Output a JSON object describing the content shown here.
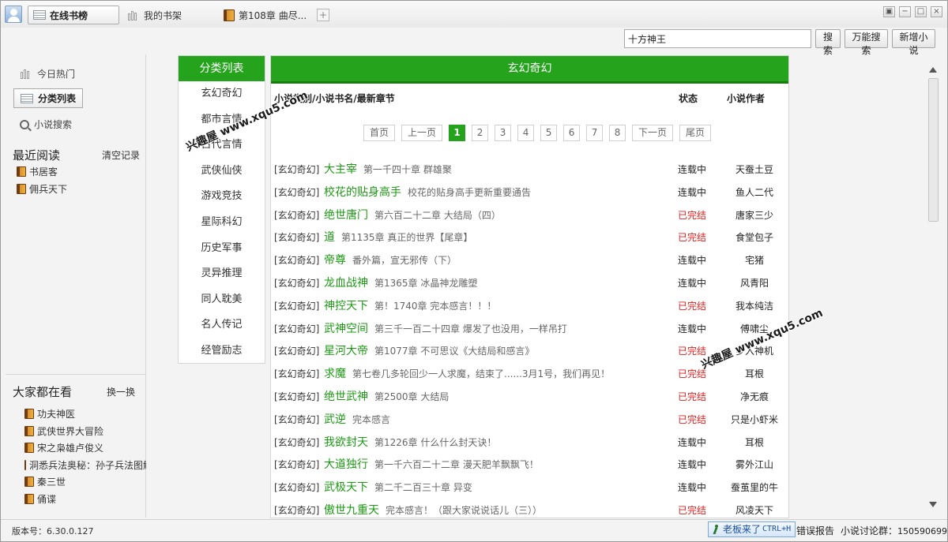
{
  "titlebar": {
    "tabs": [
      {
        "label": "在线书榜",
        "icon": "list-icon",
        "active": true
      },
      {
        "label": "我的书架",
        "icon": "bookshelf-icon",
        "active": false
      },
      {
        "label": "第108章  曲尽...",
        "icon": "book-icon",
        "active": false
      }
    ],
    "add_tab": "+",
    "window_buttons": {
      "restore": "▣",
      "minimize": "−",
      "maximize": "□",
      "close": "×"
    }
  },
  "search": {
    "value": "十方神王",
    "buttons": [
      "搜索",
      "万能搜索",
      "新增小说"
    ]
  },
  "left": {
    "nav": [
      {
        "label": "今日热门",
        "icon": "bookshelf-icon"
      },
      {
        "label": "分类列表",
        "icon": "list-icon"
      },
      {
        "label": "小说搜索",
        "icon": "search-icon"
      }
    ],
    "recent": {
      "title": "最近阅读",
      "clear": "清空记录",
      "items": [
        "书居客",
        "佣兵天下"
      ]
    },
    "popular": {
      "title": "大家都在看",
      "refresh": "换一换",
      "items": [
        "功夫神医",
        "武侠世界大冒险",
        "宋之枭雄卢俊义",
        "洞悉兵法奥秘：孙子兵法图解",
        "秦三世",
        "俑谍"
      ]
    }
  },
  "categories": {
    "title": "分类列表",
    "items": [
      "玄幻奇幻",
      "都市言情",
      "古代言情",
      "武侠仙侠",
      "游戏竞技",
      "星际科幻",
      "历史军事",
      "灵异推理",
      "同人耽美",
      "名人传记",
      "经管励志"
    ]
  },
  "main": {
    "title": "玄幻奇幻",
    "columns": {
      "book": "小说类别/小说书名/最新章节",
      "status": "状态",
      "author": "小说作者"
    },
    "pagination": {
      "first": "首页",
      "prev": "上一页",
      "pages": [
        "1",
        "2",
        "3",
        "4",
        "5",
        "6",
        "7",
        "8"
      ],
      "current": "1",
      "next": "下一页",
      "last": "尾页"
    },
    "rows": [
      {
        "category": "[玄幻奇幻]",
        "title": "大主宰",
        "chapter": "第一千四十章 群雄聚",
        "status": "连载中",
        "author": "天蚕土豆"
      },
      {
        "category": "[玄幻奇幻]",
        "title": "校花的贴身高手",
        "chapter": "校花的贴身高手更新重要通告",
        "status": "连载中",
        "author": "鱼人二代"
      },
      {
        "category": "[玄幻奇幻]",
        "title": "绝世唐门",
        "chapter": "第六百二十二章 大结局（四）",
        "status": "已完结",
        "author": "唐家三少"
      },
      {
        "category": "[玄幻奇幻]",
        "title": "道",
        "chapter": "第1135章 真正的世界【尾章】",
        "status": "已完结",
        "author": "食堂包子"
      },
      {
        "category": "[玄幻奇幻]",
        "title": "帝尊",
        "chapter": "番外篇，宣无邪传（下）",
        "status": "连载中",
        "author": "宅猪"
      },
      {
        "category": "[玄幻奇幻]",
        "title": "龙血战神",
        "chapter": "第1365章 冰晶神龙雕塑",
        "status": "连载中",
        "author": "风青阳"
      },
      {
        "category": "[玄幻奇幻]",
        "title": "神控天下",
        "chapter": "第！1740章 完本感言！！！",
        "status": "已完结",
        "author": "我本纯洁"
      },
      {
        "category": "[玄幻奇幻]",
        "title": "武神空间",
        "chapter": "第三千一百二十四章 爆发了也没用，一样吊打",
        "status": "连载中",
        "author": "傅啸尘"
      },
      {
        "category": "[玄幻奇幻]",
        "title": "星河大帝",
        "chapter": "第1077章 不可思议《大结局和感言》",
        "status": "已完结",
        "author": "梦入神机"
      },
      {
        "category": "[玄幻奇幻]",
        "title": "求魔",
        "chapter": "第七卷几多轮回少一人求魔，结束了......3月1号，我们再见！",
        "status": "已完结",
        "author": "耳根"
      },
      {
        "category": "[玄幻奇幻]",
        "title": "绝世武神",
        "chapter": "第2500章 大结局",
        "status": "已完结",
        "author": "净无痕"
      },
      {
        "category": "[玄幻奇幻]",
        "title": "武逆",
        "chapter": "完本感言",
        "status": "已完结",
        "author": "只是小虾米"
      },
      {
        "category": "[玄幻奇幻]",
        "title": "我欲封天",
        "chapter": "第1226章 什么什么封天诀！",
        "status": "连载中",
        "author": "耳根"
      },
      {
        "category": "[玄幻奇幻]",
        "title": "大道独行",
        "chapter": "第一千六百二十二章 漫天肥羊飘飘飞！",
        "status": "连载中",
        "author": "雾外江山"
      },
      {
        "category": "[玄幻奇幻]",
        "title": "武极天下",
        "chapter": "第二千二百三十章 异变",
        "status": "连载中",
        "author": "蚕茧里的牛"
      },
      {
        "category": "[玄幻奇幻]",
        "title": "傲世九重天",
        "chapter": "完本感言！（跟大家说说话儿（三））",
        "status": "已完结",
        "author": "风凌天下"
      }
    ]
  },
  "statusbar": {
    "version": "版本号：6.30.0.127",
    "boss_key": {
      "label": "老板来了",
      "shortcut": "CTRL+H"
    },
    "error_report": "错误报告",
    "discussion_label": "小说讨论群：",
    "discussion_number": "150590699"
  },
  "watermark": "兴趣屋 www.xqu5.com",
  "colors": {
    "accent_green": "#26a31c",
    "title_green": "#1d9a14",
    "done_red": "#e02020"
  }
}
